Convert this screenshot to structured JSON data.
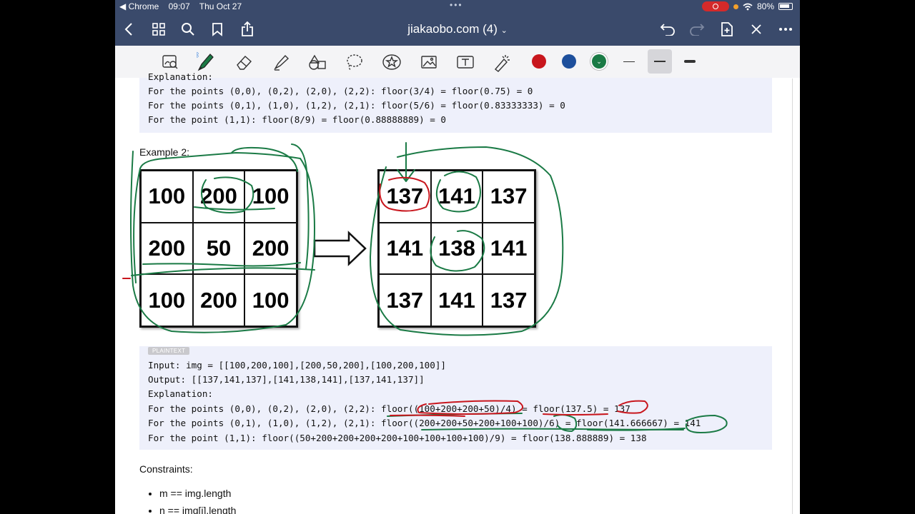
{
  "status_bar": {
    "back_app": "◀ Chrome",
    "time": "09:07",
    "date": "Thu Oct 27",
    "battery": "80%"
  },
  "nav": {
    "title": "jiakaobo.com (4)"
  },
  "toolbar": {
    "colors": [
      "#c8161d",
      "#1d4f9c",
      "#1a7a45"
    ],
    "selected_color": "#1a7a45"
  },
  "example1": {
    "explanation_partial": "Explanation:",
    "lines": [
      "For the points (0,0), (0,2), (2,0), (2,2): floor(3/4) = floor(0.75) = 0",
      "For the points (0,1), (1,0), (1,2), (2,1): floor(5/6) = floor(0.83333333) = 0",
      "For the point (1,1): floor(8/9) = floor(0.88888889) = 0"
    ]
  },
  "example2": {
    "heading": "Example 2:",
    "input_grid": [
      [
        "100",
        "200",
        "100"
      ],
      [
        "200",
        "50",
        "200"
      ],
      [
        "100",
        "200",
        "100"
      ]
    ],
    "output_grid": [
      [
        "137",
        "141",
        "137"
      ],
      [
        "141",
        "138",
        "141"
      ],
      [
        "137",
        "141",
        "137"
      ]
    ],
    "code_tag": "PLAINTEXT",
    "lines": [
      "Input: img = [[100,200,100],[200,50,200],[100,200,100]]",
      "Output: [[137,141,137],[141,138,141],[137,141,137]]",
      "Explanation:",
      "For the points (0,0), (0,2), (2,0), (2,2): floor((100+200+200+50)/4) = floor(137.5) = 137",
      "For the points (0,1), (1,0), (1,2), (2,1): floor((200+200+50+200+100+100)/6) = floor(141.666667) = 141",
      "For the point (1,1): floor((50+200+200+200+200+100+100+100+100)/9) = floor(138.888889) = 138"
    ]
  },
  "constraints": {
    "heading": "Constraints:",
    "items": [
      "m == img.length",
      "n == img[i].length"
    ]
  },
  "ink_colors": {
    "green": "#1a7a45",
    "red": "#c8161d"
  }
}
